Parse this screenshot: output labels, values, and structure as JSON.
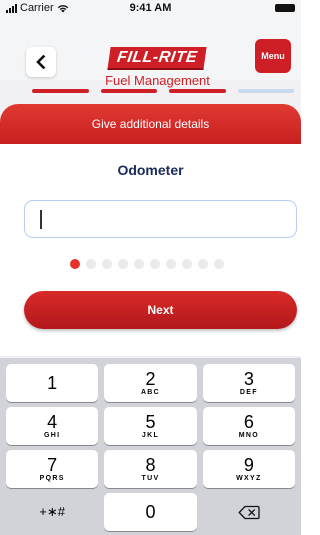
{
  "status_bar": {
    "carrier": "Carrier",
    "time": "9:41 AM"
  },
  "header": {
    "logo_main": "FILL-RITE",
    "logo_sub": "Fuel Management",
    "menu_label": "Menu"
  },
  "progress": {
    "steps_total": 4,
    "steps_completed": 3
  },
  "card": {
    "title": "Give additional details",
    "field_label": "Odometer",
    "input_value": "",
    "dots_total": 10,
    "dots_active_index": 0,
    "next_label": "Next"
  },
  "keypad": {
    "keys": [
      {
        "num": "1",
        "letters": ""
      },
      {
        "num": "2",
        "letters": "ABC"
      },
      {
        "num": "3",
        "letters": "DEF"
      },
      {
        "num": "4",
        "letters": "GHI"
      },
      {
        "num": "5",
        "letters": "JKL"
      },
      {
        "num": "6",
        "letters": "MNO"
      },
      {
        "num": "7",
        "letters": "PQRS"
      },
      {
        "num": "8",
        "letters": "TUV"
      },
      {
        "num": "9",
        "letters": "WXYZ"
      },
      {
        "num": "+∗#",
        "letters": ""
      },
      {
        "num": "0",
        "letters": ""
      }
    ]
  },
  "colors": {
    "brand_red": "#cf1f26",
    "progress_done": "#cf1f26",
    "progress_todo": "#c9daf0",
    "dot_active": "#e3322b",
    "dot_inactive": "#eaeaec"
  }
}
